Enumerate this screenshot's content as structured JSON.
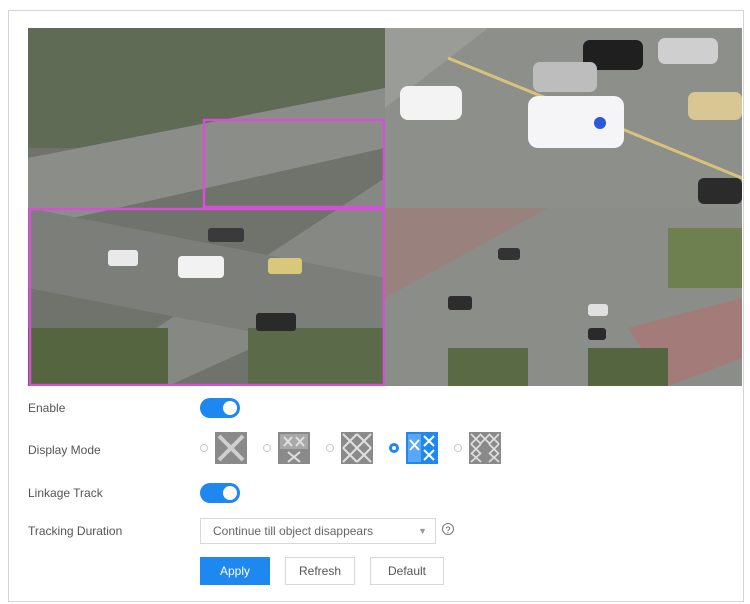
{
  "form": {
    "enable_label": "Enable",
    "display_mode_label": "Display Mode",
    "linkage_track_label": "Linkage Track",
    "tracking_duration_label": "Tracking Duration",
    "enable_on": true,
    "linkage_track_on": true,
    "display_modes_selected_index": 3,
    "tracking_duration_value": "Continue till object disappears",
    "help_glyph": "?"
  },
  "buttons": {
    "apply": "Apply",
    "refresh": "Refresh",
    "default": "Default"
  },
  "colors": {
    "accent": "#1e87f0",
    "region_outline": "#d54fd8"
  },
  "icons": {
    "help": "help-circle-icon",
    "mode_icons": [
      "layout-mode-1-icon",
      "layout-mode-2-icon",
      "layout-mode-3-icon",
      "layout-mode-4-icon",
      "layout-mode-5-icon"
    ]
  }
}
